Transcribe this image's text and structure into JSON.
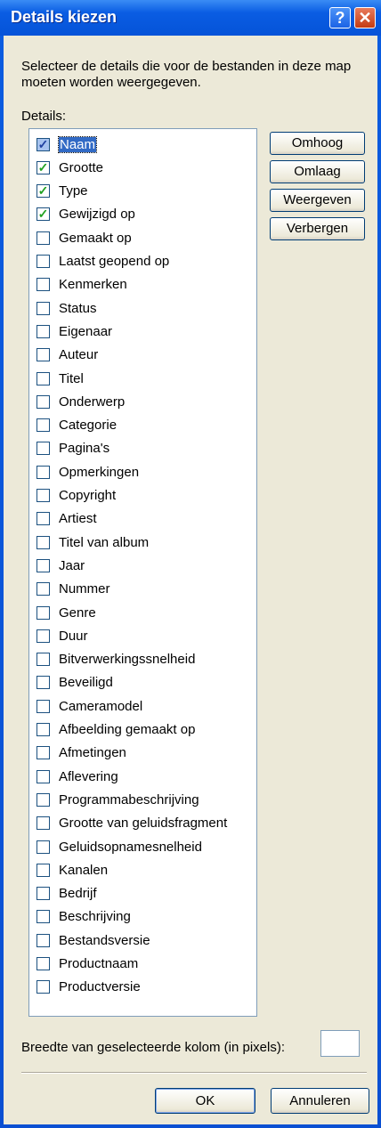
{
  "window": {
    "title": "Details kiezen",
    "help_glyph": "?",
    "close_glyph": "✕"
  },
  "description": "Selecteer de details die voor de bestanden in deze map moeten worden weergegeven.",
  "details_label": "Details:",
  "details": [
    {
      "label": "Naam",
      "checked": true,
      "selected": true
    },
    {
      "label": "Grootte",
      "checked": true
    },
    {
      "label": "Type",
      "checked": true
    },
    {
      "label": "Gewijzigd op",
      "checked": true
    },
    {
      "label": "Gemaakt op",
      "checked": false
    },
    {
      "label": "Laatst geopend op",
      "checked": false
    },
    {
      "label": "Kenmerken",
      "checked": false
    },
    {
      "label": "Status",
      "checked": false
    },
    {
      "label": "Eigenaar",
      "checked": false
    },
    {
      "label": "Auteur",
      "checked": false
    },
    {
      "label": "Titel",
      "checked": false
    },
    {
      "label": "Onderwerp",
      "checked": false
    },
    {
      "label": "Categorie",
      "checked": false
    },
    {
      "label": "Pagina's",
      "checked": false
    },
    {
      "label": "Opmerkingen",
      "checked": false
    },
    {
      "label": "Copyright",
      "checked": false
    },
    {
      "label": "Artiest",
      "checked": false
    },
    {
      "label": "Titel van album",
      "checked": false
    },
    {
      "label": "Jaar",
      "checked": false
    },
    {
      "label": "Nummer",
      "checked": false
    },
    {
      "label": "Genre",
      "checked": false
    },
    {
      "label": "Duur",
      "checked": false
    },
    {
      "label": "Bitverwerkingssnelheid",
      "checked": false
    },
    {
      "label": "Beveiligd",
      "checked": false
    },
    {
      "label": "Cameramodel",
      "checked": false
    },
    {
      "label": "Afbeelding gemaakt op",
      "checked": false
    },
    {
      "label": "Afmetingen",
      "checked": false
    },
    {
      "label": "Aflevering",
      "checked": false
    },
    {
      "label": "Programmabeschrijving",
      "checked": false
    },
    {
      "label": "Grootte van geluidsfragment",
      "checked": false
    },
    {
      "label": "Geluidsopnamesnelheid",
      "checked": false
    },
    {
      "label": "Kanalen",
      "checked": false
    },
    {
      "label": "Bedrijf",
      "checked": false
    },
    {
      "label": "Beschrijving",
      "checked": false
    },
    {
      "label": "Bestandsversie",
      "checked": false
    },
    {
      "label": "Productnaam",
      "checked": false
    },
    {
      "label": "Productversie",
      "checked": false
    }
  ],
  "buttons": {
    "up": "Omhoog",
    "down": "Omlaag",
    "show": "Weergeven",
    "hide": "Verbergen",
    "ok": "OK",
    "cancel": "Annuleren"
  },
  "width_label": "Breedte van geselecteerde kolom (in pixels):",
  "width_value": "",
  "colors": {
    "title_bar": "#0a5de3",
    "dialog_bg": "#ece9d8",
    "selection": "#316ac5",
    "check": "#21a121",
    "close_button": "#c43b12"
  }
}
